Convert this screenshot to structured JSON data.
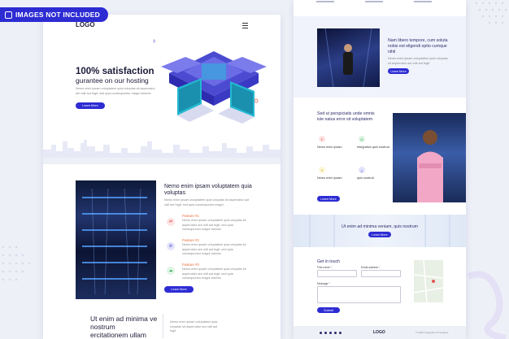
{
  "badge": {
    "label": "IMAGES NOT INCLUDED"
  },
  "hero": {
    "logo": "LOGO",
    "title_line1": "100% satisfaction",
    "title_line2": "gurantee on our hosting",
    "body": "Nemo enim ipsam voluptatem quia voluptas sit aspernatur aut odit aut fugit, sed quia consequuntur magni dolores",
    "button": "Learn More"
  },
  "section2": {
    "title": "Nemo enim ipsam voluptatem quia voluptas",
    "body": "Nemo enim ipsam voluptatem quia voluptas sit aspernatur aut odit aut fugit, sed quia consequuntur magni",
    "features": [
      {
        "title": "Feature #1",
        "text": "Nemo enim ipsam voluptatem quia voluptas sit aspernatur aut odit aut fugit, sed quia consequuntur magni dolores"
      },
      {
        "title": "Feature #2",
        "text": "Nemo enim ipsam voluptatem quia voluptas sit aspernatur aut odit aut fugit, sed quia consequuntur magni dolores"
      },
      {
        "title": "Feature #3",
        "text": "Nemo enim ipsam voluptatem quia voluptas sit aspernatur aut odit aut fugit, sed quia consequuntur magni dolores"
      }
    ],
    "button": "Learn More"
  },
  "section3": {
    "title_line1": "Ut enim ad minima ve",
    "title_line2": "nostrum",
    "title_line3": "ercitationem ullam"
  },
  "right": {
    "block1": {
      "title": "Nam libero tempore, cum soluta nobis est eligendi optio cumque nihil",
      "body": "Nemo enim ipsam voluptatem quia voluptas sit aspernatur aut odit aut fugit",
      "button": "Learn More"
    },
    "block2": {
      "title": "Sed ut perspiciatis unde omnis iste natus error sit voluptatem",
      "items": [
        {
          "title": "Nemo enim ipsam"
        },
        {
          "title": "Integration quis nostrud"
        },
        {
          "title": "Nemo enim ipsam"
        },
        {
          "title": "quis nostrud"
        }
      ],
      "button": "Learn More"
    },
    "banner": {
      "title": "Ut enim ad minima veniam, quis nostrum",
      "button": "Learn More"
    },
    "contact": {
      "title": "Get in touch",
      "name_label": "First name *",
      "email_label": "Email address *",
      "message_label": "Message *",
      "button": "Submit"
    },
    "footer": {
      "logo": "LOGO",
      "copyright": "© 2020 Copyright of Company"
    }
  },
  "colors": {
    "accent": "#2d2cd3",
    "accent_dark": "#1c1c3a",
    "orange": "#e86b3a"
  }
}
